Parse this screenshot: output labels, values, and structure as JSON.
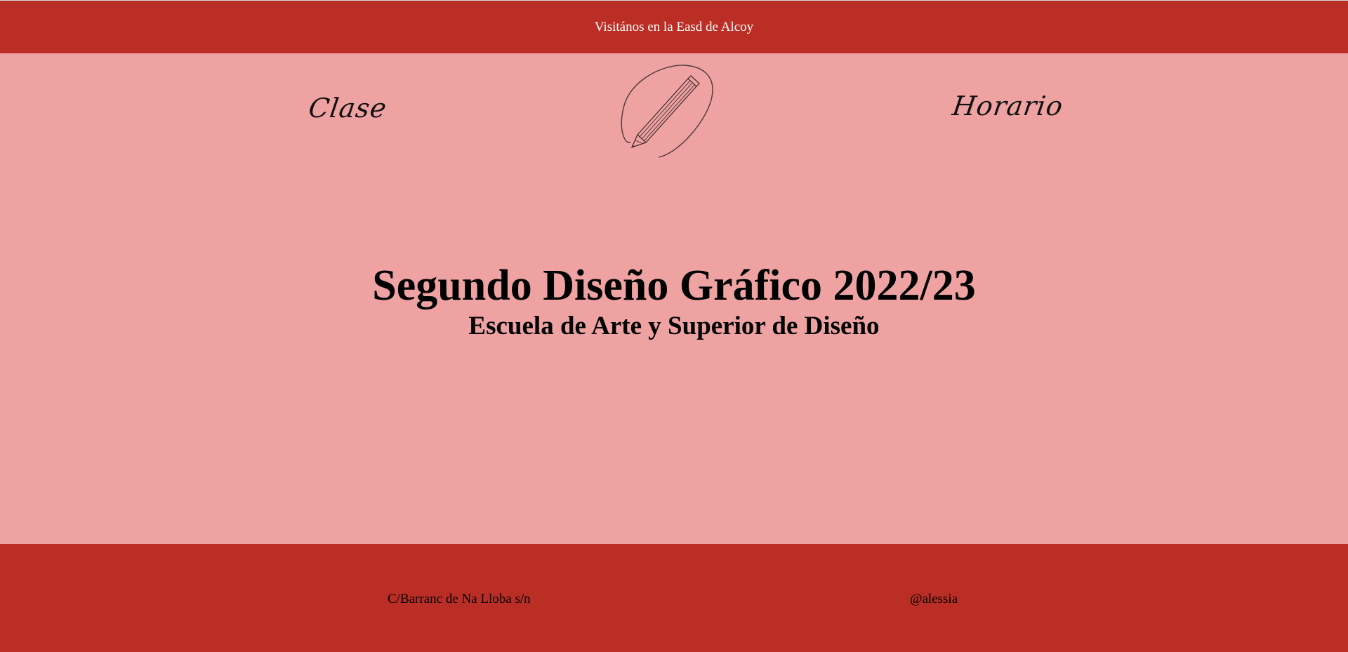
{
  "topbar": {
    "text": "Visitános en la Easd de Alcoy"
  },
  "nav": {
    "left_label": "Clase",
    "right_label": "Horario"
  },
  "logo": {
    "icon": "pencil-circle-icon"
  },
  "hero": {
    "title": "Segundo Diseño Gráfico 2022/23",
    "subtitle": "Escuela de Arte y Superior de Diseño"
  },
  "footer": {
    "address": "C/Barranc de Na Lloba s/n",
    "handle": "@alessia"
  },
  "colors": {
    "bar": "#bb2e25",
    "background": "#efa2a2",
    "text": "#000000",
    "topbar_text": "#ffffff"
  }
}
